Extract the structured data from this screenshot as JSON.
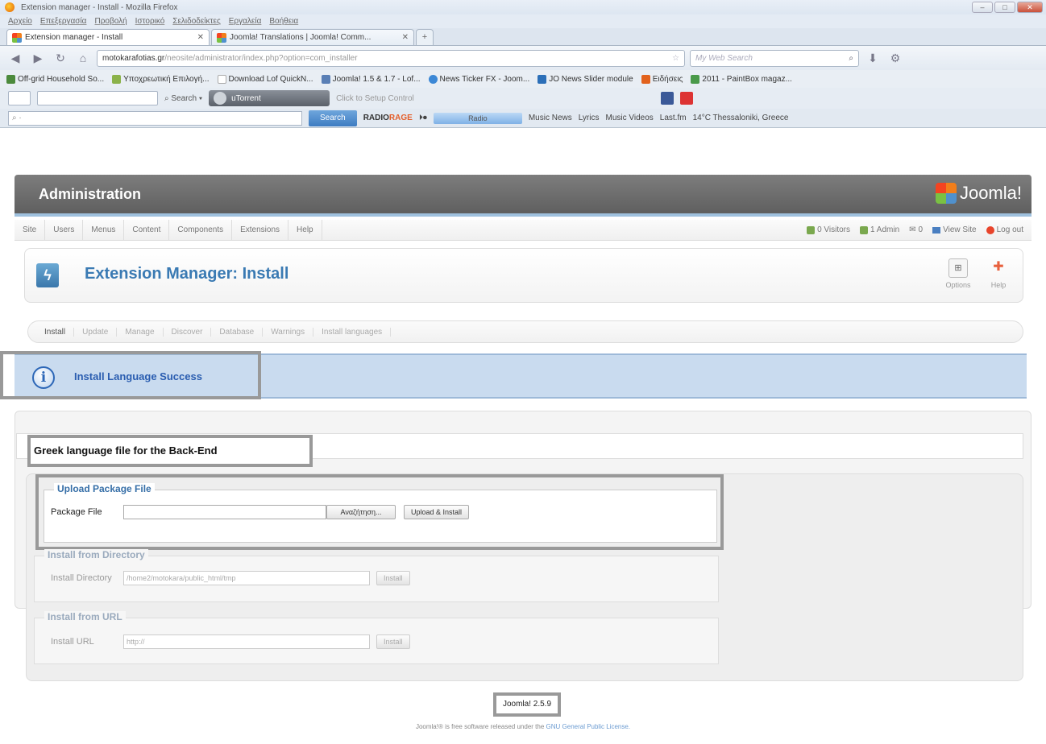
{
  "browser": {
    "window_title": "Extension manager - Install - Mozilla Firefox",
    "menu": [
      "Αρχείο",
      "Επεξεργασία",
      "Προβολή",
      "Ιστορικό",
      "Σελιδοδείκτες",
      "Εργαλεία",
      "Βοήθεια"
    ],
    "tabs": [
      {
        "label": "Extension manager - Install",
        "active": true
      },
      {
        "label": "Joomla! Translations | Joomla! Comm...",
        "active": false
      }
    ],
    "url_host": "motokarafotias.gr",
    "url_path": "/neosite/administrator/index.php?option=com_installer",
    "search_placeholder": "My Web Search",
    "bookmarks": [
      {
        "label": "Off-grid Household So...",
        "color": "#4c8a3c"
      },
      {
        "label": "Υποχρεωτική Επιλογή...",
        "color": "#8bb24a"
      },
      {
        "label": "Download Lof QuickN...",
        "color": "#cccccc"
      },
      {
        "label": "Joomla! 1.5 & 1.7 - Lof...",
        "color": "#5a7fb5"
      },
      {
        "label": "News Ticker FX - Joom...",
        "color": "#3c88d6"
      },
      {
        "label": "JO News Slider module",
        "color": "#2c6fb8"
      },
      {
        "label": "Ειδήσεις",
        "color": "#e2621d"
      },
      {
        "label": "2011 - PaintBox magaz...",
        "color": "#4a9a4a"
      }
    ],
    "toolbar2": {
      "search_label": "Search",
      "utorrent_label": "uTorrent",
      "setup_label": "Click to Setup Control"
    },
    "toolbar3": {
      "search_button": "Search",
      "radiorage_a": "RADIO",
      "radiorage_b": "RAGE",
      "radio_label": "Radio",
      "links": [
        "Music News",
        "Lyrics",
        "Music Videos",
        "Last.fm",
        "14°C Thessaloniki, Greece"
      ]
    }
  },
  "admin": {
    "header_title": "Administration",
    "logo_text": "Joomla!",
    "menu": [
      "Site",
      "Users",
      "Menus",
      "Content",
      "Components",
      "Extensions",
      "Help"
    ],
    "status": {
      "visitors": "0 Visitors",
      "admins": "1 Admin",
      "messages": "0",
      "view_site": "View Site",
      "logout": "Log out"
    },
    "page_title": "Extension Manager: Install",
    "toolbar": {
      "options_label": "Options",
      "help_label": "Help"
    },
    "subtabs": [
      "Install",
      "Update",
      "Manage",
      "Discover",
      "Database",
      "Warnings",
      "Install languages"
    ],
    "message": "Install Language Success",
    "result_title": "Greek language file for the Back-End",
    "upload": {
      "legend": "Upload Package File",
      "label": "Package File",
      "browse": "Αναζήτηση...",
      "button": "Upload & Install"
    },
    "directory": {
      "legend": "Install from Directory",
      "label": "Install Directory",
      "value": "/home2/motokara/public_html/tmp",
      "button": "Install"
    },
    "url": {
      "legend": "Install from URL",
      "label": "Install URL",
      "value": "http://",
      "button": "Install"
    },
    "version": "Joomla! 2.5.9",
    "license_prefix": "Joomla!® is free software released under the",
    "license_link": "GNU General Public License."
  }
}
